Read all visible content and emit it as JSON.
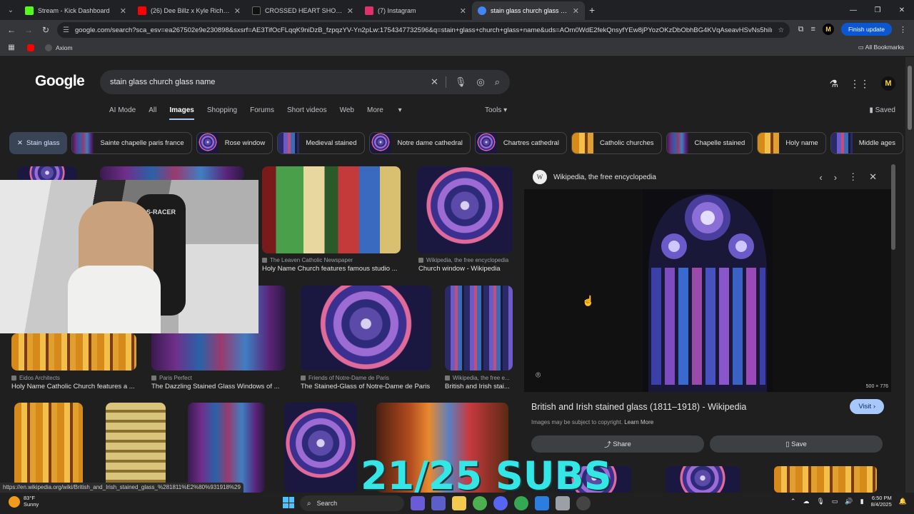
{
  "browser": {
    "tabs": [
      {
        "label": "Stream - Kick Dashboard",
        "color": "#53fc18"
      },
      {
        "label": "(26) Dee Billz x Kyle Richh - Tap",
        "color": "#ff0000"
      },
      {
        "label": "CROSSED HEART SHORT SLEEVE",
        "color": "#111111"
      },
      {
        "label": "(7) Instagram",
        "color": "#e1306c"
      },
      {
        "label": "stain glass church glass name -",
        "color": "#4285f4"
      }
    ],
    "url": "google.com/search?sca_esv=ea267502e9e230898&sxsrf=AE3TifOcFLqqK9niDzB_fzpqzYV-Yn2pLw:1754347732596&q=stain+glass+church+glass+name&uds=AOm0WdE2fekQnsyfYEw8jPYozOKzDbObhBG4KVqAseavHSvNs5hiIrgeJPJRLL...",
    "profile_initial": "M",
    "finish_update": "Finish update",
    "bookmarks": [
      {
        "label": "Axiom"
      }
    ],
    "all_bookmarks": "All Bookmarks"
  },
  "google": {
    "logo": "Google",
    "query": "stain glass church glass name",
    "nav": [
      "AI Mode",
      "All",
      "Images",
      "Shopping",
      "Forums",
      "Short videos",
      "Web",
      "More"
    ],
    "tools": "Tools",
    "saved": "Saved",
    "chips": [
      "Stain glass",
      "Sainte chapelle paris france",
      "Rose window",
      "Medieval stained",
      "Notre dame cathedral",
      "Chartres cathedral",
      "Catholic churches",
      "Chapelle stained",
      "Holy name",
      "Middle ages"
    ],
    "results": [
      {
        "source": "The Leaven Catholic Newspaper",
        "title": "Holy Name Church features famous studio ..."
      },
      {
        "source": "Wikipedia, the free encyclopedia",
        "title": "Church window - Wikipedia"
      },
      {
        "source": "Eidos Architects",
        "title": "Holy Name Catholic Church features a ..."
      },
      {
        "source": "Paris Perfect",
        "title": "The Dazzling Stained Glass Windows of ..."
      },
      {
        "source": "Friends of Notre-Dame de Paris",
        "title": "The Stained-Glass of Notre-Dame de Paris"
      },
      {
        "source": "Wikipedia, the free e...",
        "title": "British and Irish stai..."
      }
    ],
    "preview": {
      "site": "Wikipedia, the free encyclopedia",
      "site_logo": "W",
      "dims": "500 × 776",
      "title": "British and Irish stained glass (1811–1918) - Wikipedia",
      "visit": "Visit",
      "copyright": "Images may be subject to copyright.",
      "learn_more": "Learn More",
      "share": "Share",
      "save": "Save"
    },
    "status_url": "https://en.wikipedia.org/wiki/British_and_Irish_stained_glass_%281811%E2%80%931918%29"
  },
  "overlay": {
    "subs_counter": "21/25 SUBS",
    "chair_brand": "S-RACER"
  },
  "taskbar": {
    "weather_temp": "83°F",
    "weather_desc": "Sunny",
    "search": "Search",
    "time": "6:50 PM",
    "date": "8/4/2025"
  }
}
